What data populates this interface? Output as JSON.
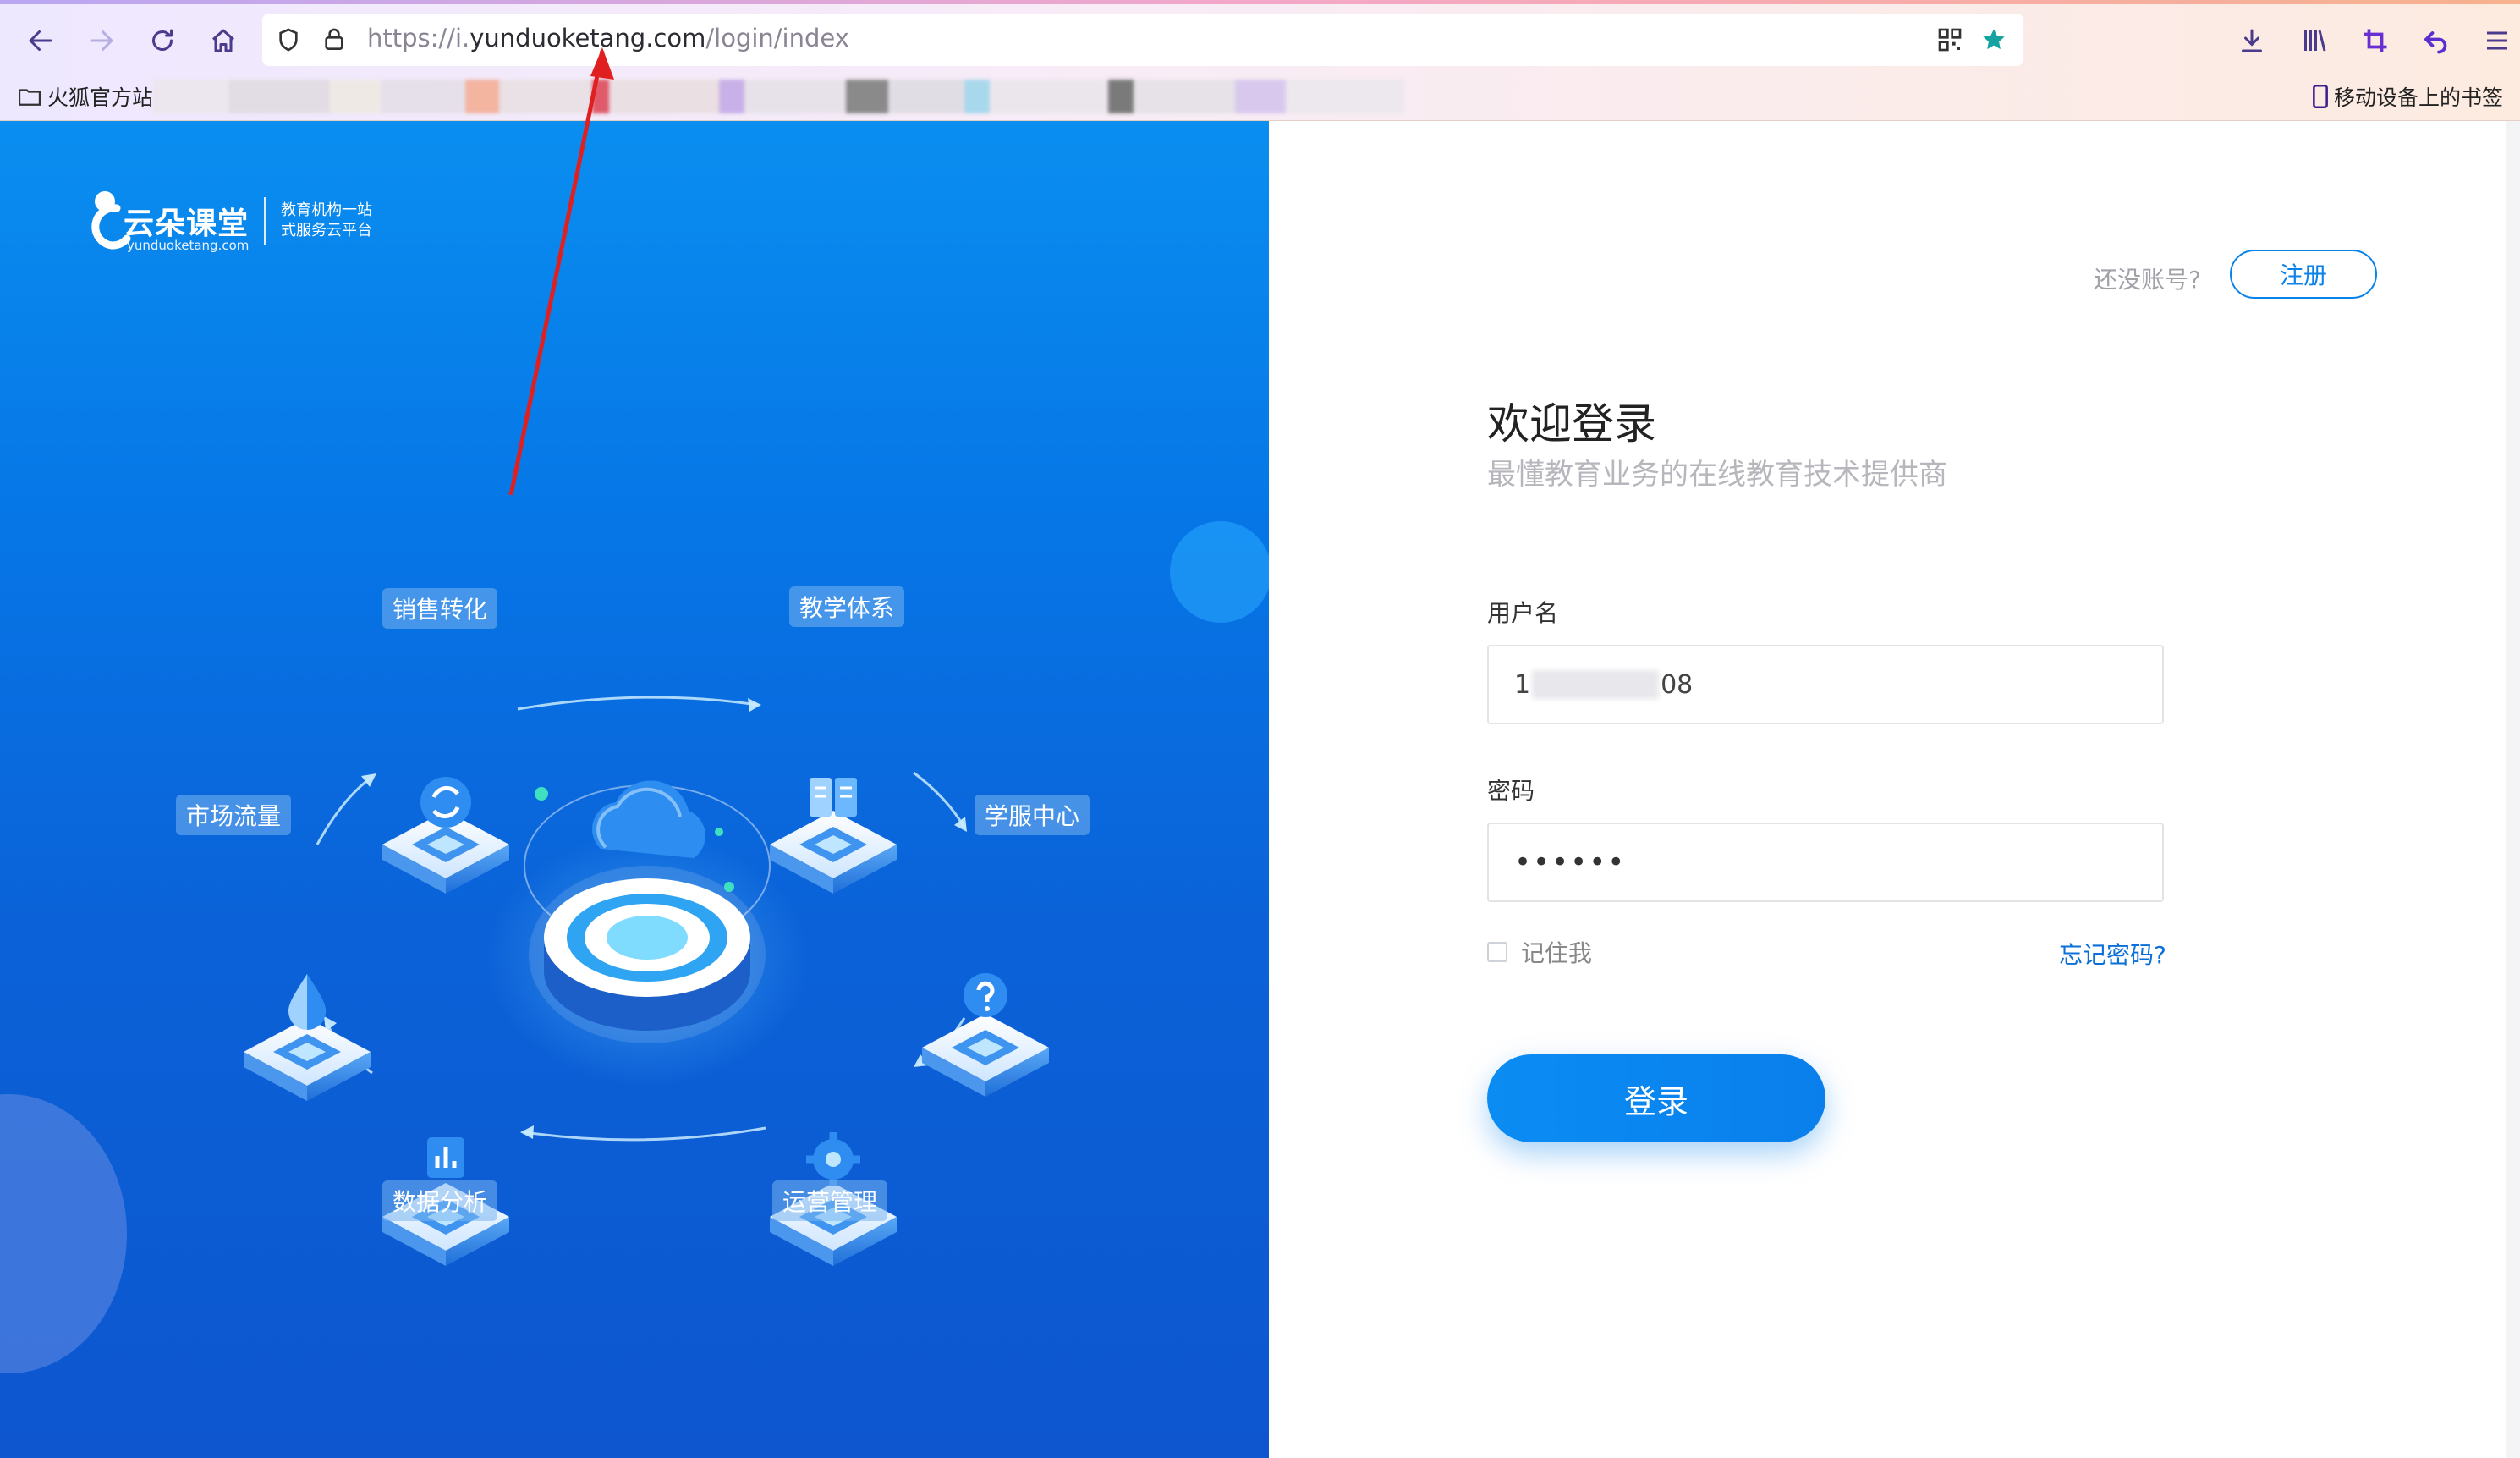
{
  "browser": {
    "url_prefix": "https://i.",
    "url_host": "yunduoketang.com",
    "url_path": "/login/index",
    "bookmark_folder": "火狐官方站",
    "mobile_bookmarks": "移动设备上的书签"
  },
  "brand": {
    "name": "云朵课堂",
    "url": "yunduoketang.com",
    "slogan_line1": "教育机构一站",
    "slogan_line2": "式服务云平台"
  },
  "diagram": {
    "nodes": [
      {
        "label": "销售转化"
      },
      {
        "label": "教学体系"
      },
      {
        "label": "学服中心"
      },
      {
        "label": "运营管理"
      },
      {
        "label": "数据分析"
      },
      {
        "label": "市场流量"
      }
    ]
  },
  "login": {
    "no_account": "还没账号?",
    "register": "注册",
    "welcome": "欢迎登录",
    "subtitle": "最懂教育业务的在线教育技术提供商",
    "username_label": "用户名",
    "username_prefix": "1",
    "username_suffix": "08",
    "password_label": "密码",
    "password_value": "••••••",
    "remember_me": "记住我",
    "forgot_password": "忘记密码?",
    "submit": "登录"
  },
  "colors": {
    "accent": "#0a82ea",
    "annotation": "#e02020"
  }
}
